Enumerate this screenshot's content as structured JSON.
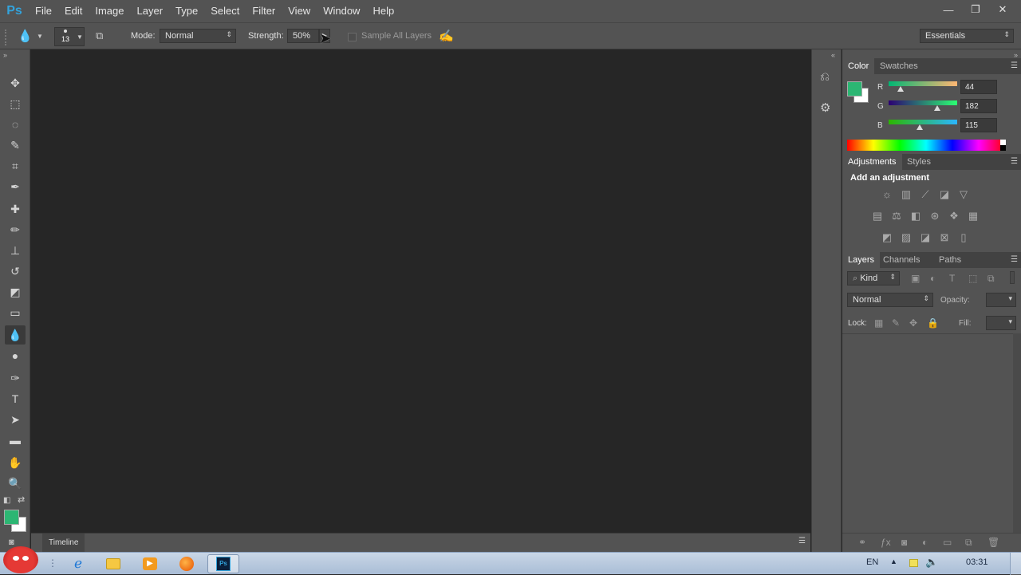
{
  "app": {
    "logo": "Ps"
  },
  "menu": [
    "File",
    "Edit",
    "Image",
    "Layer",
    "Type",
    "Select",
    "Filter",
    "View",
    "Window",
    "Help"
  ],
  "window_controls": {
    "minimize": "—",
    "restore": "❐",
    "close": "✕"
  },
  "options": {
    "brush_size": "13",
    "mode_label": "Mode:",
    "mode_value": "Normal",
    "strength_label": "Strength:",
    "strength_value": "50%",
    "sample_all_layers": "Sample All Layers",
    "workspace": "Essentials"
  },
  "tools": [
    {
      "name": "move-tool",
      "icon": "✥"
    },
    {
      "name": "marquee-tool",
      "icon": "⬚"
    },
    {
      "name": "lasso-tool",
      "icon": "◌"
    },
    {
      "name": "quick-selection-tool",
      "icon": "✎"
    },
    {
      "name": "crop-tool",
      "icon": "⌗"
    },
    {
      "name": "eyedropper-tool",
      "icon": "✒"
    },
    {
      "name": "healing-brush-tool",
      "icon": "✚"
    },
    {
      "name": "brush-tool",
      "icon": "✏"
    },
    {
      "name": "clone-stamp-tool",
      "icon": "⊥"
    },
    {
      "name": "history-brush-tool",
      "icon": "↺"
    },
    {
      "name": "eraser-tool",
      "icon": "◩"
    },
    {
      "name": "gradient-tool",
      "icon": "▭"
    },
    {
      "name": "blur-tool",
      "icon": "💧"
    },
    {
      "name": "dodge-tool",
      "icon": "●"
    },
    {
      "name": "pen-tool",
      "icon": "✑"
    },
    {
      "name": "type-tool",
      "icon": "T"
    },
    {
      "name": "path-selection-tool",
      "icon": "➤"
    },
    {
      "name": "rectangle-tool",
      "icon": "▬"
    },
    {
      "name": "hand-tool",
      "icon": "✋"
    },
    {
      "name": "zoom-tool",
      "icon": "🔍"
    }
  ],
  "colors": {
    "foreground": "#2cb673",
    "background": "#ffffff"
  },
  "timeline": {
    "label": "Timeline"
  },
  "color_panel": {
    "tabs": [
      "Color",
      "Swatches"
    ],
    "r_label": "R",
    "g_label": "G",
    "b_label": "B",
    "r": "44",
    "g": "182",
    "b": "115"
  },
  "adjustments_panel": {
    "tabs": [
      "Adjustments",
      "Styles"
    ],
    "title": "Add an adjustment"
  },
  "layers_panel": {
    "tabs": [
      "Layers",
      "Channels",
      "Paths"
    ],
    "kind": "Kind",
    "blend_mode": "Normal",
    "opacity_label": "Opacity:",
    "lock_label": "Lock:",
    "fill_label": "Fill:"
  },
  "taskbar": {
    "language": "EN",
    "time": "03:31"
  }
}
